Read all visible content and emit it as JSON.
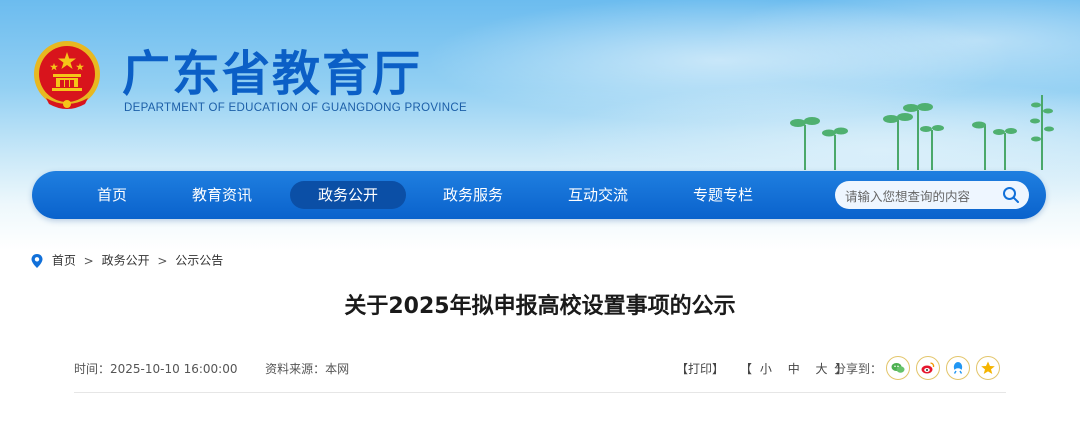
{
  "header": {
    "title": "广东省教育厅",
    "subtitle": "DEPARTMENT OF EDUCATION OF GUANGDONG PROVINCE"
  },
  "nav": {
    "items": [
      {
        "label": "首页"
      },
      {
        "label": "教育资讯"
      },
      {
        "label": "政务公开",
        "active": true
      },
      {
        "label": "政务服务"
      },
      {
        "label": "互动交流"
      },
      {
        "label": "专题专栏"
      }
    ],
    "search_placeholder": "请输入您想查询的内容"
  },
  "breadcrumb": {
    "items": [
      "首页",
      "政务公开",
      "公示公告"
    ],
    "separator": ">"
  },
  "article": {
    "title": "关于2025年拟申报高校设置事项的公示",
    "time_label": "时间：",
    "time_value": "2025-10-10 16:00:00",
    "source_label": "资料来源：",
    "source_value": "本网"
  },
  "tools": {
    "print": "【打印】",
    "font_open": "【",
    "font_small": "小",
    "font_medium": "中",
    "font_large": "大",
    "font_close": "】",
    "share_label": "分享到："
  },
  "share": [
    "wechat-icon",
    "weibo-icon",
    "qq-icon",
    "qzone-icon"
  ],
  "colors": {
    "brand": "#0b5fc6",
    "nav_bg": "#1170d9",
    "nav_active": "#0b4fa6",
    "emblem_red": "#d8141c",
    "emblem_gold": "#f5c518"
  }
}
